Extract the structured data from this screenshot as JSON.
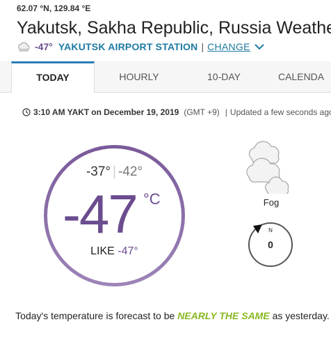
{
  "location": {
    "coords": "62.07 °N, 129.84 °E",
    "title": "Yakutsk, Sakha Republic, Russia Weather",
    "current_temp": "-47°",
    "station": "YAKUTSK AIRPORT STATION",
    "separator": "|",
    "change_label": "CHANGE"
  },
  "tabs": [
    {
      "label": "TODAY",
      "active": true
    },
    {
      "label": "HOURLY",
      "active": false
    },
    {
      "label": "10-DAY",
      "active": false
    },
    {
      "label": "CALENDA",
      "active": false
    }
  ],
  "timestamp": {
    "time": "3:10 AM YAKT",
    "date": "on December 19, 2019",
    "gmt": "(GMT +9)",
    "separator": "|",
    "updated": "Updated a few seconds ago"
  },
  "current": {
    "high": "-37°",
    "low": "-42°",
    "separator": "|",
    "temp": "-47",
    "unit": "°C",
    "feels_label": "LIKE",
    "feels_value": "-47°",
    "condition": "Fog",
    "wind_dir": "N",
    "wind_speed": "0"
  },
  "forecast": {
    "prefix": "Today's temperature is forecast to be",
    "highlight": "NEARLY THE SAME",
    "suffix": "as yesterday."
  },
  "colors": {
    "accent_purple": "#6b4c8f",
    "link_blue": "#1d7aa3",
    "highlight_green": "#8ab821"
  }
}
